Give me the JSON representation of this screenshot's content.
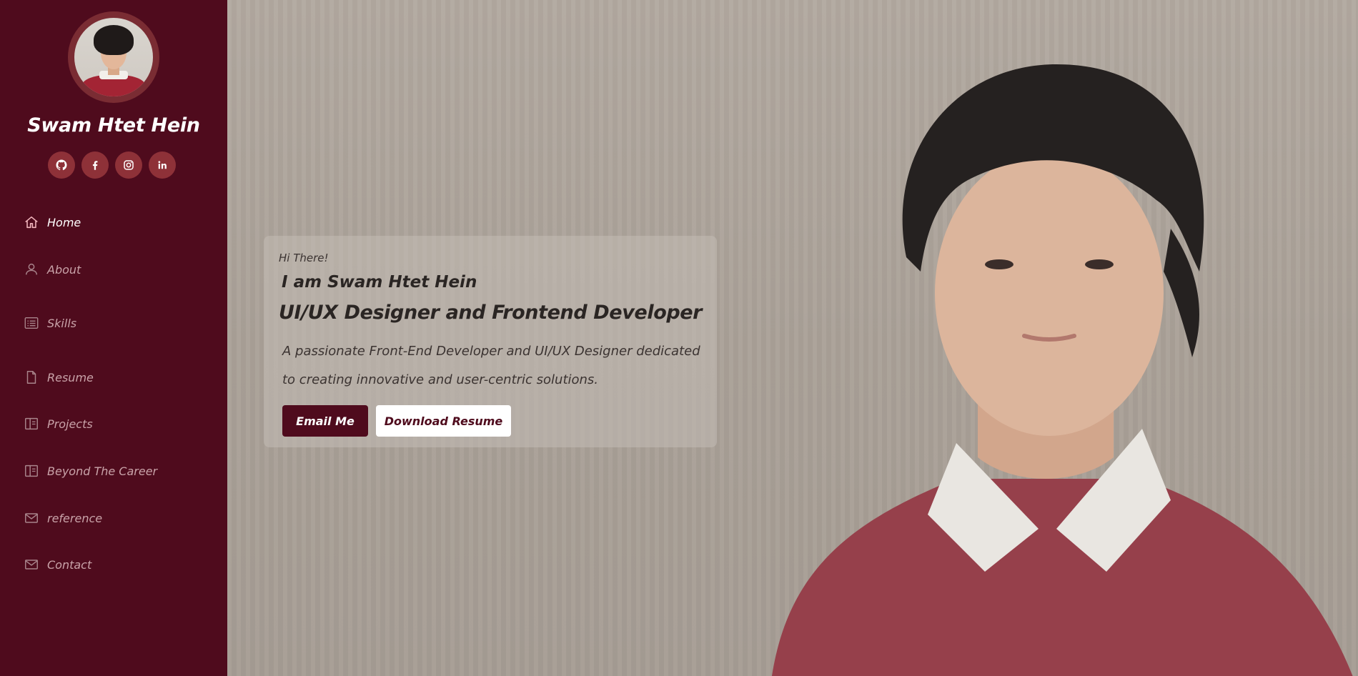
{
  "profile": {
    "name": "Swam Htet Hein",
    "avatar_icon": "profile-photo"
  },
  "socials": [
    {
      "name": "github",
      "icon": "github-icon"
    },
    {
      "name": "facebook",
      "icon": "facebook-icon"
    },
    {
      "name": "instagram",
      "icon": "instagram-icon"
    },
    {
      "name": "linkedin",
      "icon": "linkedin-icon"
    }
  ],
  "nav": {
    "items": [
      {
        "label": "Home",
        "icon": "home-icon",
        "active": true
      },
      {
        "label": "About",
        "icon": "user-icon",
        "active": false
      },
      {
        "label": "Skills",
        "icon": "list-icon",
        "active": false
      },
      {
        "label": "Resume",
        "icon": "document-icon",
        "active": false
      },
      {
        "label": "Projects",
        "icon": "book-icon",
        "active": false
      },
      {
        "label": "Beyond The Career",
        "icon": "book-icon",
        "active": false
      },
      {
        "label": "reference",
        "icon": "mail-icon",
        "active": false
      },
      {
        "label": "Contact",
        "icon": "mail-icon",
        "active": false
      }
    ]
  },
  "hero": {
    "greeting": "Hi There!",
    "intro": "I am Swam Htet Hein",
    "role": "UI/UX Designer and Frontend Developer",
    "description": "A passionate Front-End Developer and UI/UX Designer dedicated to creating innovative and user-centric solutions.",
    "email_button": "Email Me",
    "resume_button": "Download Resume"
  },
  "colors": {
    "sidebar_bg": "#4f0b1d",
    "social_bg": "#8e3138",
    "accent": "#4f0b1d",
    "main_bg": "#aaa198"
  }
}
